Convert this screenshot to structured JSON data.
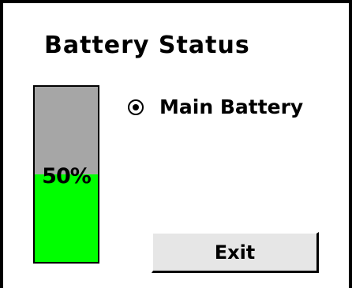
{
  "window": {
    "title": "Battery Status"
  },
  "battery": {
    "percent_label": "50%",
    "fill_fraction": 0.5,
    "fill_color": "#00ff00",
    "empty_color": "#a6a6a6"
  },
  "battery_select": {
    "label": "Main Battery",
    "selected": true
  },
  "actions": {
    "exit_label": "Exit"
  }
}
